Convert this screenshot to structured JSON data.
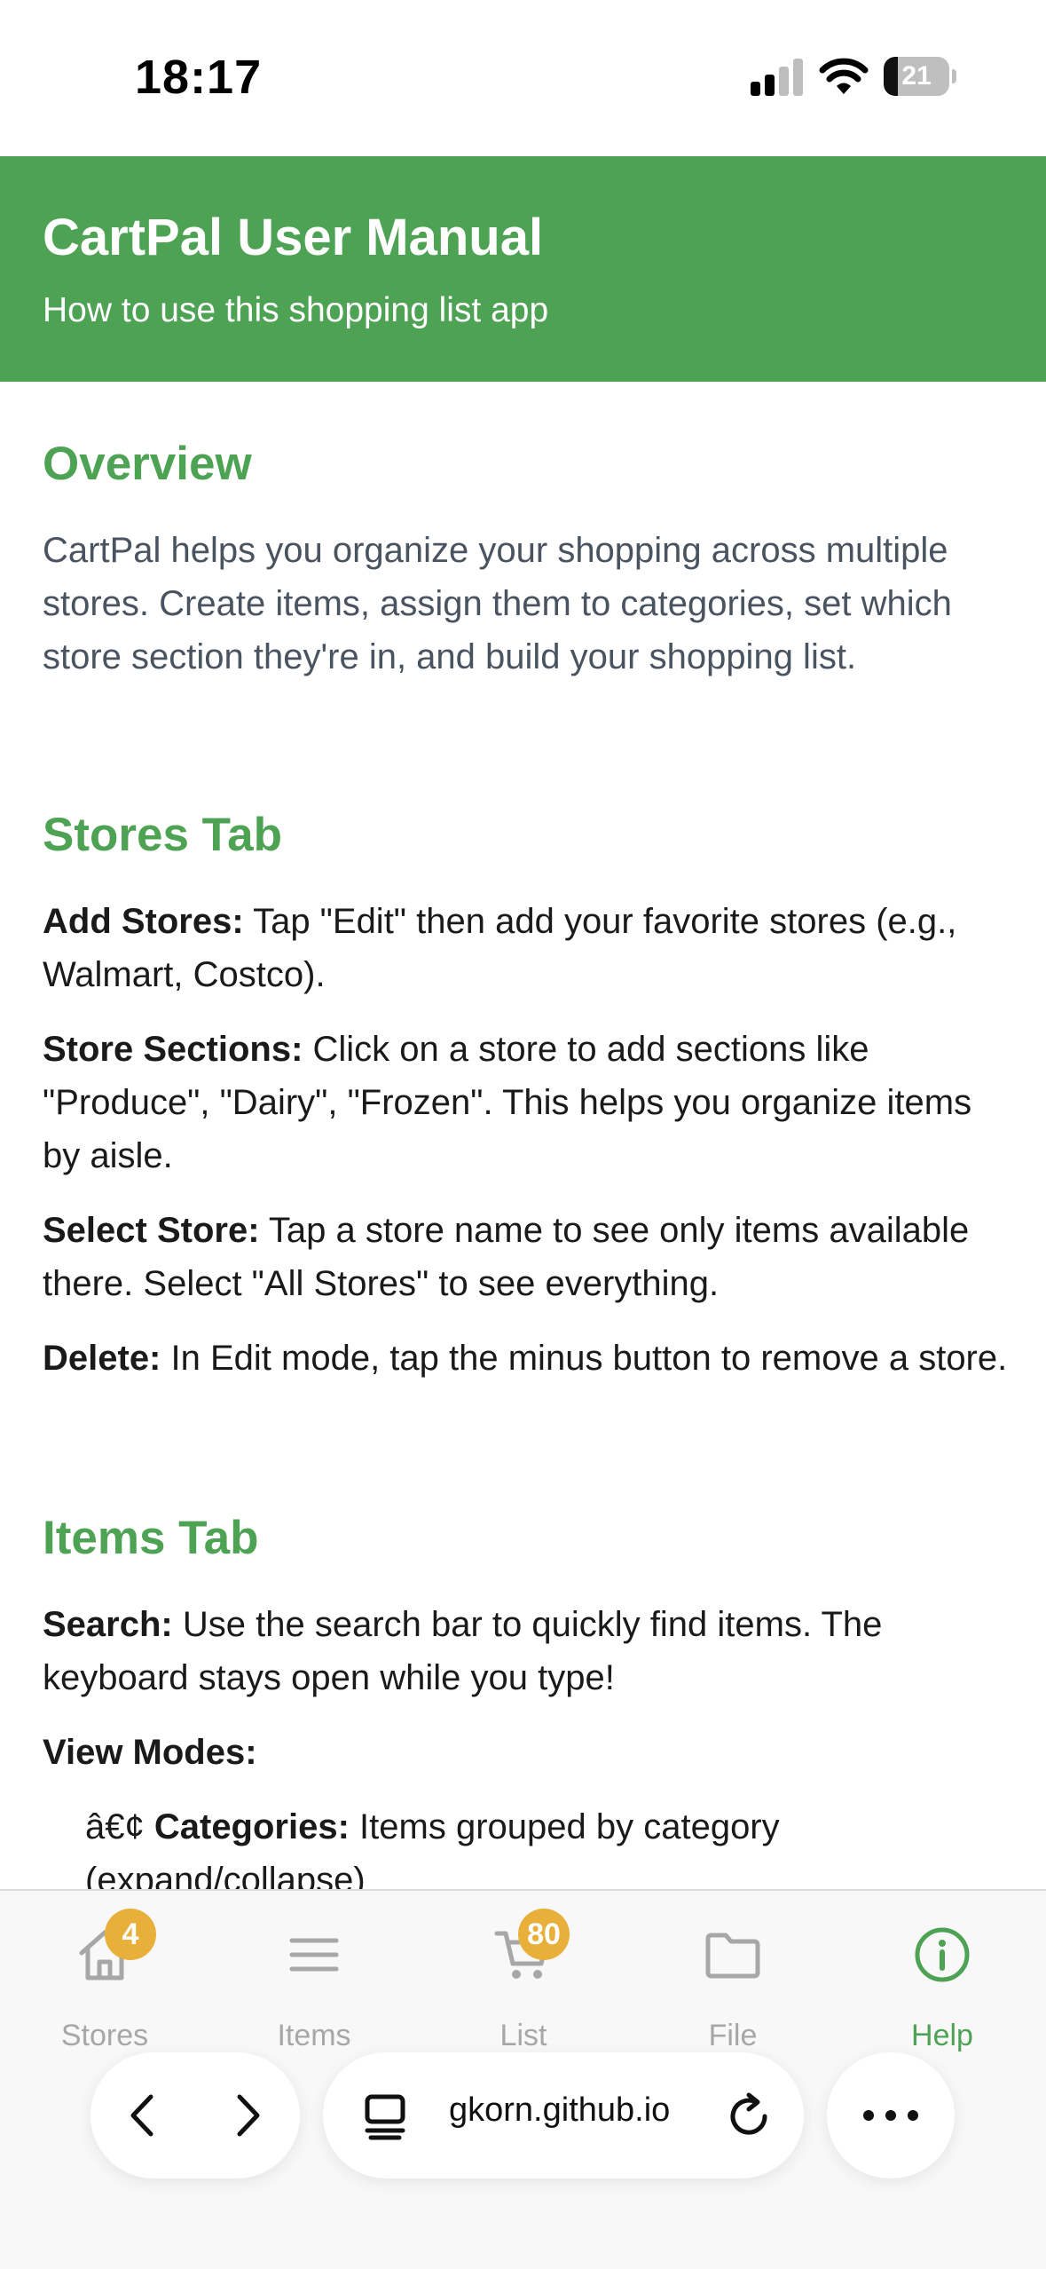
{
  "status": {
    "time": "18:17",
    "battery": "21",
    "battery_level": 0.21
  },
  "header": {
    "title": "CartPal User Manual",
    "subtitle": "How to use this shopping list app",
    "color": "#4ea254"
  },
  "sections": {
    "overview": {
      "heading": "Overview",
      "body": "CartPal helps you organize your shopping across multiple stores. Create items, assign them to categories, set which store section they're in, and build your shopping list."
    },
    "stores": {
      "heading": "Stores Tab",
      "items": [
        {
          "term": "Add Stores:",
          "text": " Tap \"Edit\" then add your favorite stores (e.g., Walmart, Costco)."
        },
        {
          "term": "Store Sections:",
          "text": " Click on a store to add sections like \"Produce\", \"Dairy\", \"Frozen\". This helps you organize items by aisle."
        },
        {
          "term": "Select Store:",
          "text": " Tap a store name to see only items available there. Select \"All Stores\" to see everything."
        },
        {
          "term": "Delete:",
          "text": " In Edit mode, tap the minus button to remove a store."
        }
      ]
    },
    "items": {
      "heading": "Items Tab",
      "search_term": "Search:",
      "search_text": " Use the search bar to quickly find items. The keyboard stays open while you type!",
      "view_modes": "View Modes:",
      "bullet_prefix": "â€¢ ",
      "bullet_term": "Categories:",
      "bullet_text": " Items grouped by category (expand/collapse)"
    }
  },
  "tabs": [
    {
      "label": "Stores",
      "icon": "home-icon",
      "badge": "4"
    },
    {
      "label": "Items",
      "icon": "list-icon"
    },
    {
      "label": "List",
      "icon": "cart-icon",
      "badge": "80"
    },
    {
      "label": "File",
      "icon": "folder-icon"
    },
    {
      "label": "Help",
      "icon": "info-icon",
      "active": true
    }
  ],
  "browser": {
    "url": "gkorn.github.io"
  }
}
